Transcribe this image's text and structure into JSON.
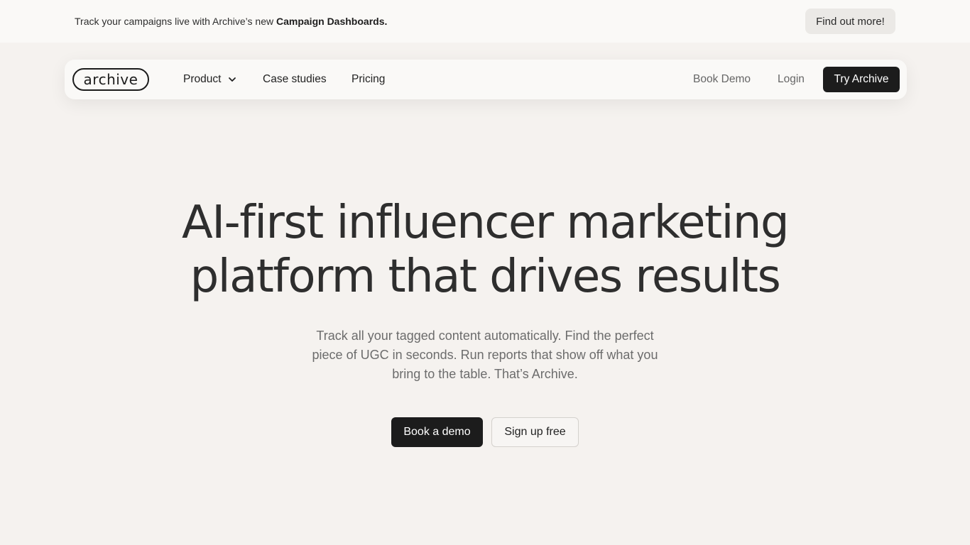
{
  "announcement": {
    "text_prefix": "Track your campaigns live with Archive’s new ",
    "text_bold": "Campaign Dashboards.",
    "cta_label": "Find out more!"
  },
  "nav": {
    "logo_text": "archive",
    "items": [
      {
        "label": "Product",
        "has_dropdown": true
      },
      {
        "label": "Case studies"
      },
      {
        "label": "Pricing"
      }
    ],
    "book_demo_label": "Book Demo",
    "login_label": "Login",
    "try_label": "Try Archive"
  },
  "hero": {
    "title_line1": "AI-first influencer marketing",
    "title_line2": "platform that drives results",
    "subtitle": "Track all your tagged content automatically. Find the perfect piece of UGC in seconds. Run reports that show off what you bring to the table. That’s Archive.",
    "primary_cta": "Book a demo",
    "secondary_cta": "Sign up free"
  },
  "colors": {
    "background": "#f5f2ef",
    "primary_button": "#1c1c1c"
  }
}
